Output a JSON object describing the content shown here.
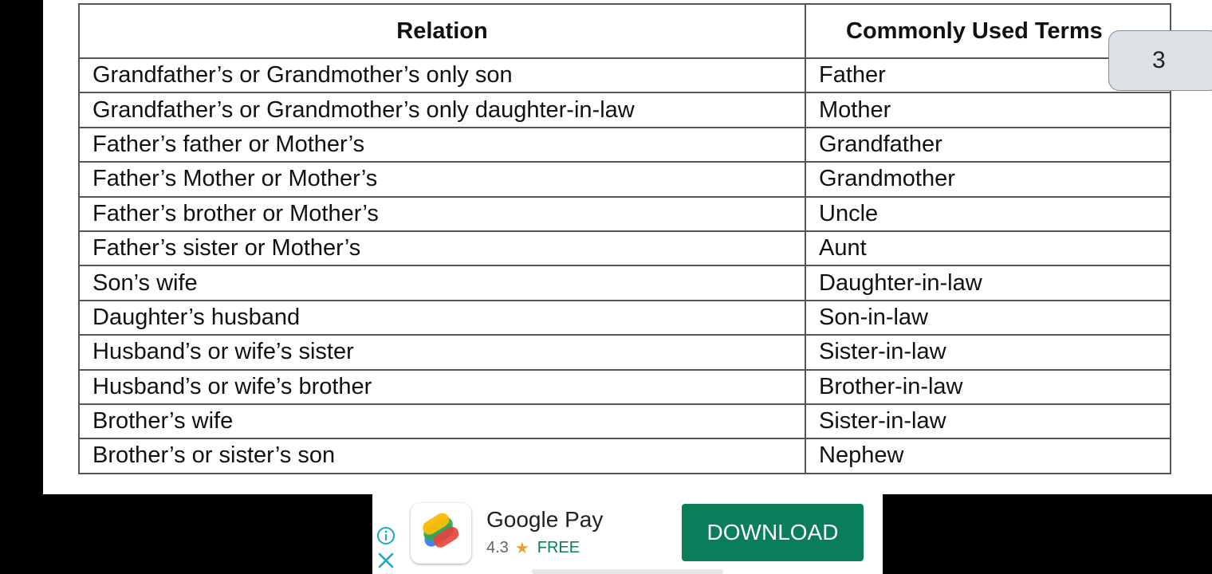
{
  "table": {
    "headers": [
      "Relation",
      "Commonly Used Terms"
    ],
    "rows": [
      [
        "Grandfather’s or Grandmother’s only son",
        "Father"
      ],
      [
        "Grandfather’s or Grandmother’s only daughter-in-law",
        "Mother"
      ],
      [
        "Father’s father or Mother’s",
        "Grandfather"
      ],
      [
        "Father’s Mother or Mother’s",
        "Grandmother"
      ],
      [
        "Father’s brother or Mother’s",
        "Uncle"
      ],
      [
        "Father’s sister or Mother’s",
        "Aunt"
      ],
      [
        "Son’s wife",
        "Daughter-in-law"
      ],
      [
        "Daughter’s husband",
        "Son-in-law"
      ],
      [
        "Husband’s or wife’s sister",
        "Sister-in-law"
      ],
      [
        "Husband’s or wife’s brother",
        "Brother-in-law"
      ],
      [
        "Brother’s wife",
        "Sister-in-law"
      ],
      [
        "Brother’s or sister’s son",
        "Nephew"
      ]
    ]
  },
  "page_indicator": {
    "number": "3"
  },
  "ad": {
    "app_name": "Google Pay",
    "rating": "4.3",
    "rating_icon": "star-icon",
    "price": "FREE",
    "cta_label": "DOWNLOAD",
    "info_icon": "info-icon",
    "close_icon": "close-icon",
    "accent_color": "#0a7d5a"
  }
}
